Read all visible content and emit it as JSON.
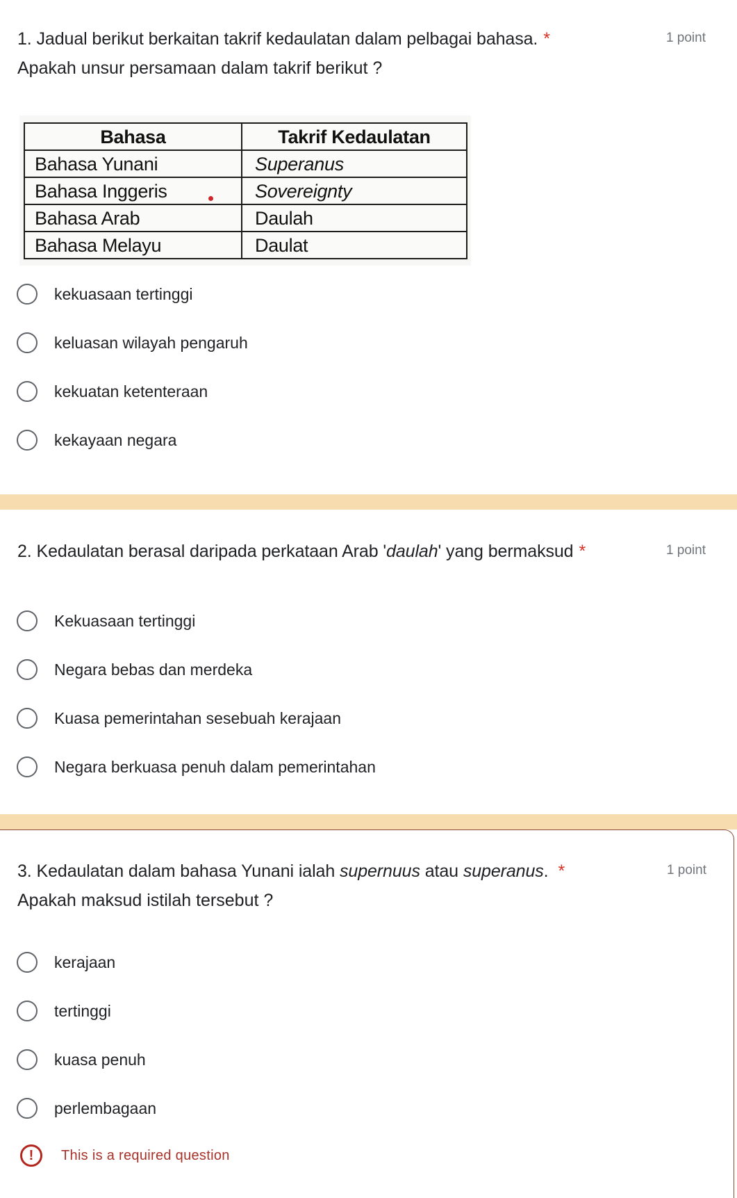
{
  "colors": {
    "separator": "#f6dcae",
    "required_star": "#d93025",
    "error": "#b3261e",
    "error_card_border": "#8a4a36"
  },
  "questions": [
    {
      "number": "1.",
      "title": "Jadual berikut berkaitan takrif kedaulatan dalam pelbagai bahasa.",
      "required_mark": "*",
      "points": "1 point",
      "subtitle": "Apakah unsur persamaan dalam takrif berikut ?",
      "table": {
        "headers": [
          "Bahasa",
          "Takrif Kedaulatan"
        ],
        "rows": [
          [
            "Bahasa Yunani",
            "Superanus"
          ],
          [
            "Bahasa Inggeris",
            "Sovereignty"
          ],
          [
            "Bahasa Arab",
            "Daulah"
          ],
          [
            "Bahasa Melayu",
            "Daulat"
          ]
        ]
      },
      "options": [
        "kekuasaan tertinggi",
        "keluasan wilayah pengaruh",
        "kekuatan ketenteraan",
        "kekayaan negara"
      ]
    },
    {
      "number": "2.",
      "title_before": "Kedaulatan berasal daripada perkataan Arab '",
      "title_italic": "daulah",
      "title_after": "' yang bermaksud",
      "required_mark": "*",
      "points": "1 point",
      "options": [
        "Kekuasaan tertinggi",
        "Negara bebas dan merdeka",
        "Kuasa pemerintahan sesebuah kerajaan",
        "Negara berkuasa penuh dalam pemerintahan"
      ]
    },
    {
      "number": "3.",
      "title_before": "Kedaulatan dalam bahasa Yunani ialah ",
      "title_italic_1": "supernuus",
      "title_middle": " atau ",
      "title_italic_2": "superanus",
      "title_after": ".",
      "required_mark": "*",
      "points": "1 point",
      "subtitle": "Apakah maksud istilah tersebut ?",
      "options": [
        "kerajaan",
        "tertinggi",
        "kuasa penuh",
        "perlembagaan"
      ],
      "error": {
        "icon": "exclamation-circle-icon",
        "icon_glyph": "!",
        "message": "This is a required question"
      }
    }
  ]
}
